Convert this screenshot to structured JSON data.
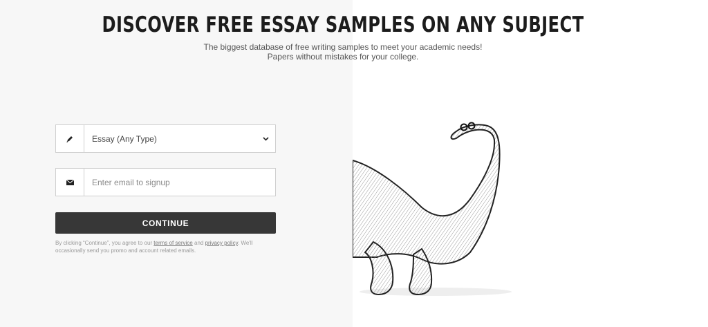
{
  "hero": {
    "title": "DISCOVER FREE ESSAY SAMPLES ON ANY SUBJECT",
    "subtitle_line1": "The biggest database of free writing samples to meet your academic needs!",
    "subtitle_line2": "Papers without mistakes for your college."
  },
  "form": {
    "type_select": {
      "value": "Essay (Any Type)",
      "icon": "pen-icon"
    },
    "email": {
      "placeholder": "Enter email to signup",
      "value": "",
      "icon": "envelope-icon"
    },
    "continue_label": "CONTINUE",
    "legal": {
      "prefix": "By clicking “Continue”, you agree to our ",
      "terms_link": "terms of service",
      "and": " and ",
      "privacy_link": "privacy policy",
      "suffix": ". We'll occasionally send you promo and account related emails."
    }
  },
  "illustration": {
    "icon": "dinosaur-illustration"
  },
  "colors": {
    "left_panel_bg": "#f7f7f7",
    "button_bg": "#373737",
    "title_text": "#1c1c1c"
  }
}
